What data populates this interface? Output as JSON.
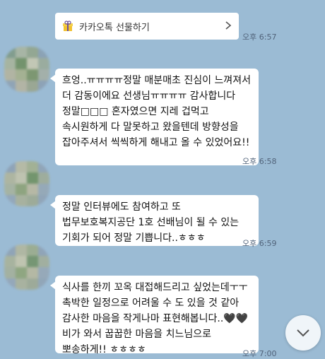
{
  "gift": {
    "label": "카카오톡 선물하기",
    "time": "오후 6:57"
  },
  "messages": [
    {
      "text": "흐엉..ㅠㅠㅠㅠ정말 매분매초 진심이 느껴져서 더 감동이에요 선생님ㅠㅠㅠㅠ 감사합니다 정말□□□ 혼자였으면 지레 겁먹고 속시원하게 다 말못하고 왔을텐데 방향성을 잡아주셔서 씩씩하게 해내고 올 수 있었어요!!",
      "time": "오후 6:58"
    },
    {
      "text": "정말 인터뷰에도 참여하고 또 법무보호복지공단 1호 선배님이 될 수 있는 기회가 되어 정말 기쁩니다..ㅎㅎㅎ",
      "time": "오후 6:59"
    },
    {
      "text": "식사를 한끼 꼬옥 대접해드리고 싶었는데ㅜㅜ 촉박한 일정으로 어려울 수 도 있을 것 같아 감사한 마음을 작게나마 표현해봅니다..🖤🖤비가 와서 꿉꿉한 마음을 치느님으로 뽀송하게!! ㅎㅎㅎㅎ",
      "time": "오후 7:00"
    }
  ],
  "colors": {
    "background": "#9bbbd4",
    "bubble": "#ffffff",
    "time": "#51637a"
  }
}
